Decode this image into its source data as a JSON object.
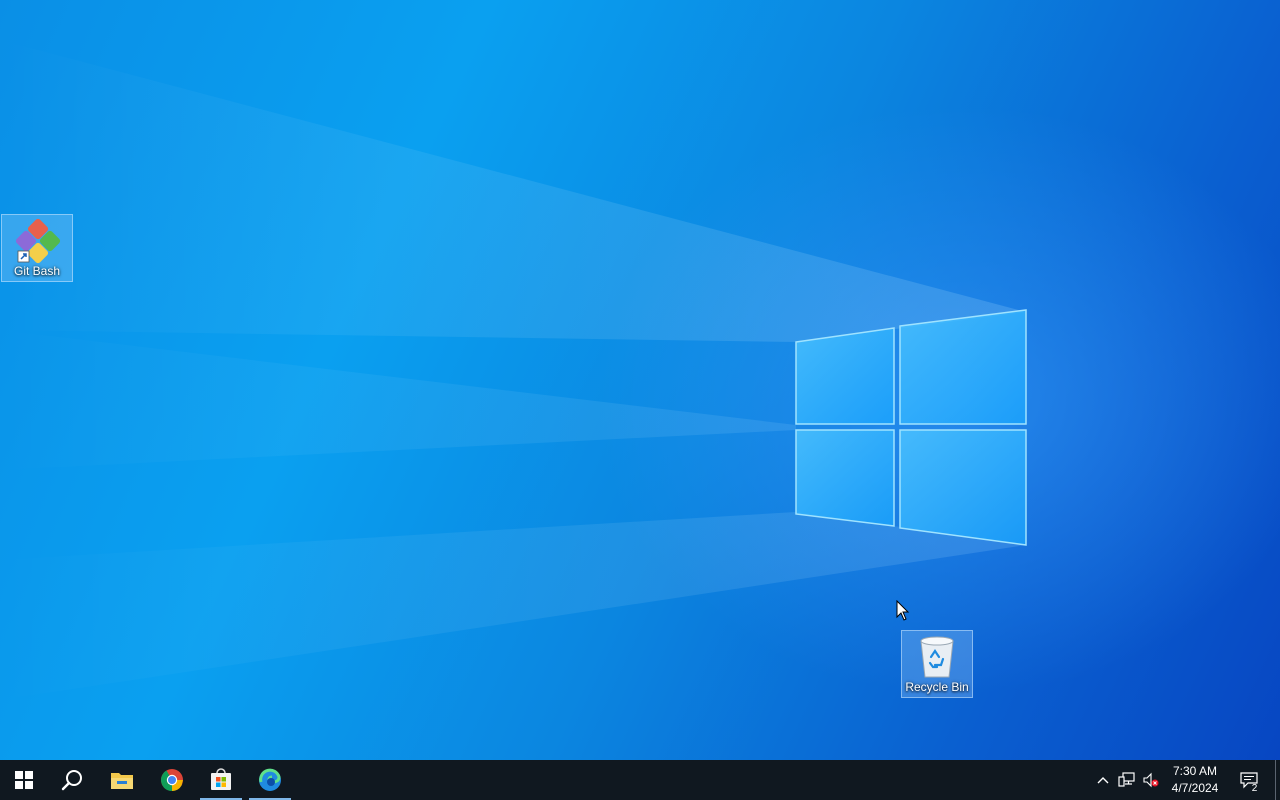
{
  "desktop": {
    "icons": [
      {
        "label": "Git Bash",
        "icon": "git-bash-icon"
      },
      {
        "label": "Recycle Bin",
        "icon": "recycle-bin-icon"
      }
    ]
  },
  "taskbar": {
    "start": {
      "icon": "windows-start-icon"
    },
    "search": {
      "icon": "search-icon"
    },
    "apps": [
      {
        "name": "File Explorer",
        "icon": "file-explorer-icon",
        "active": false
      },
      {
        "name": "Google Chrome",
        "icon": "chrome-icon",
        "active": false
      },
      {
        "name": "Microsoft Store",
        "icon": "store-icon",
        "active": true
      },
      {
        "name": "Microsoft Edge",
        "icon": "edge-icon",
        "active": true
      }
    ],
    "tray": {
      "icons": [
        "chevron-up-icon",
        "network-icon",
        "volume-muted-icon"
      ],
      "time": "7:30 AM",
      "date": "4/7/2024",
      "notifications_count": "2"
    }
  },
  "colors": {
    "taskbar": "#101820",
    "desktop_accent": "#0a8fe6",
    "active_indicator": "#7fb7e8"
  }
}
